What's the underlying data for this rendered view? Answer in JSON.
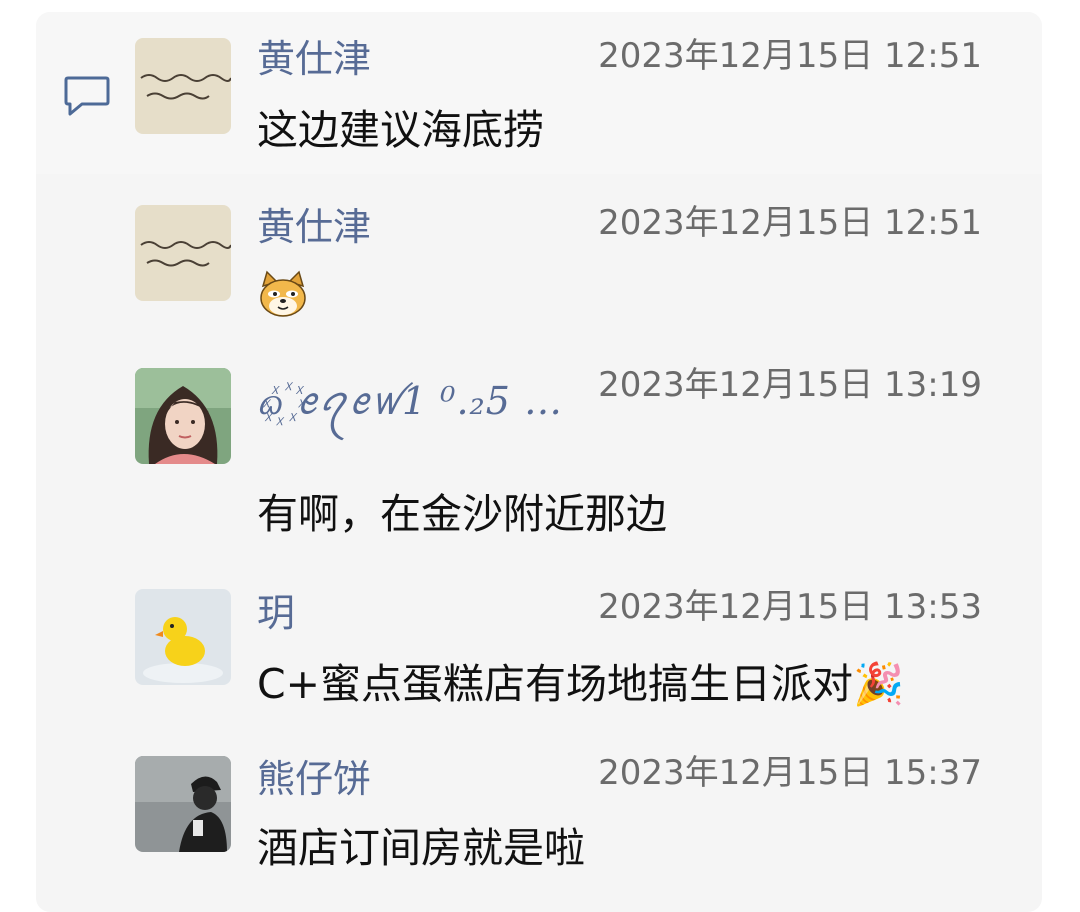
{
  "messages": [
    {
      "name": "黄仕津",
      "time": "2023年12月15日 12:51",
      "text": "这边建议海底捞",
      "avatar": "handwriting-note-avatar"
    },
    {
      "name": "黄仕津",
      "time": "2023年12月15日 12:51",
      "sticker": "doge-emoji",
      "avatar": "handwriting-note-avatar"
    },
    {
      "name": "ᦒ꙰ ꫀꪖꫀꪝ1 ⁰.₂5 …",
      "time": "2023年12月15日 13:19",
      "text": "有啊，在金沙附近那边",
      "avatar": "woman-portrait-avatar"
    },
    {
      "name": "玥",
      "time": "2023年12月15日 13:53",
      "text": "C+蜜点蛋糕店有场地搞生日派对🎉",
      "avatar": "rubber-duck-avatar"
    },
    {
      "name": "熊仔饼",
      "time": "2023年12月15日 15:37",
      "text": "酒店订间房就是啦",
      "avatar": "person-cap-avatar"
    }
  ],
  "colors": {
    "name": "#576b95",
    "time": "#6b6b6b",
    "text": "#111111",
    "panel": "#f5f5f5"
  }
}
